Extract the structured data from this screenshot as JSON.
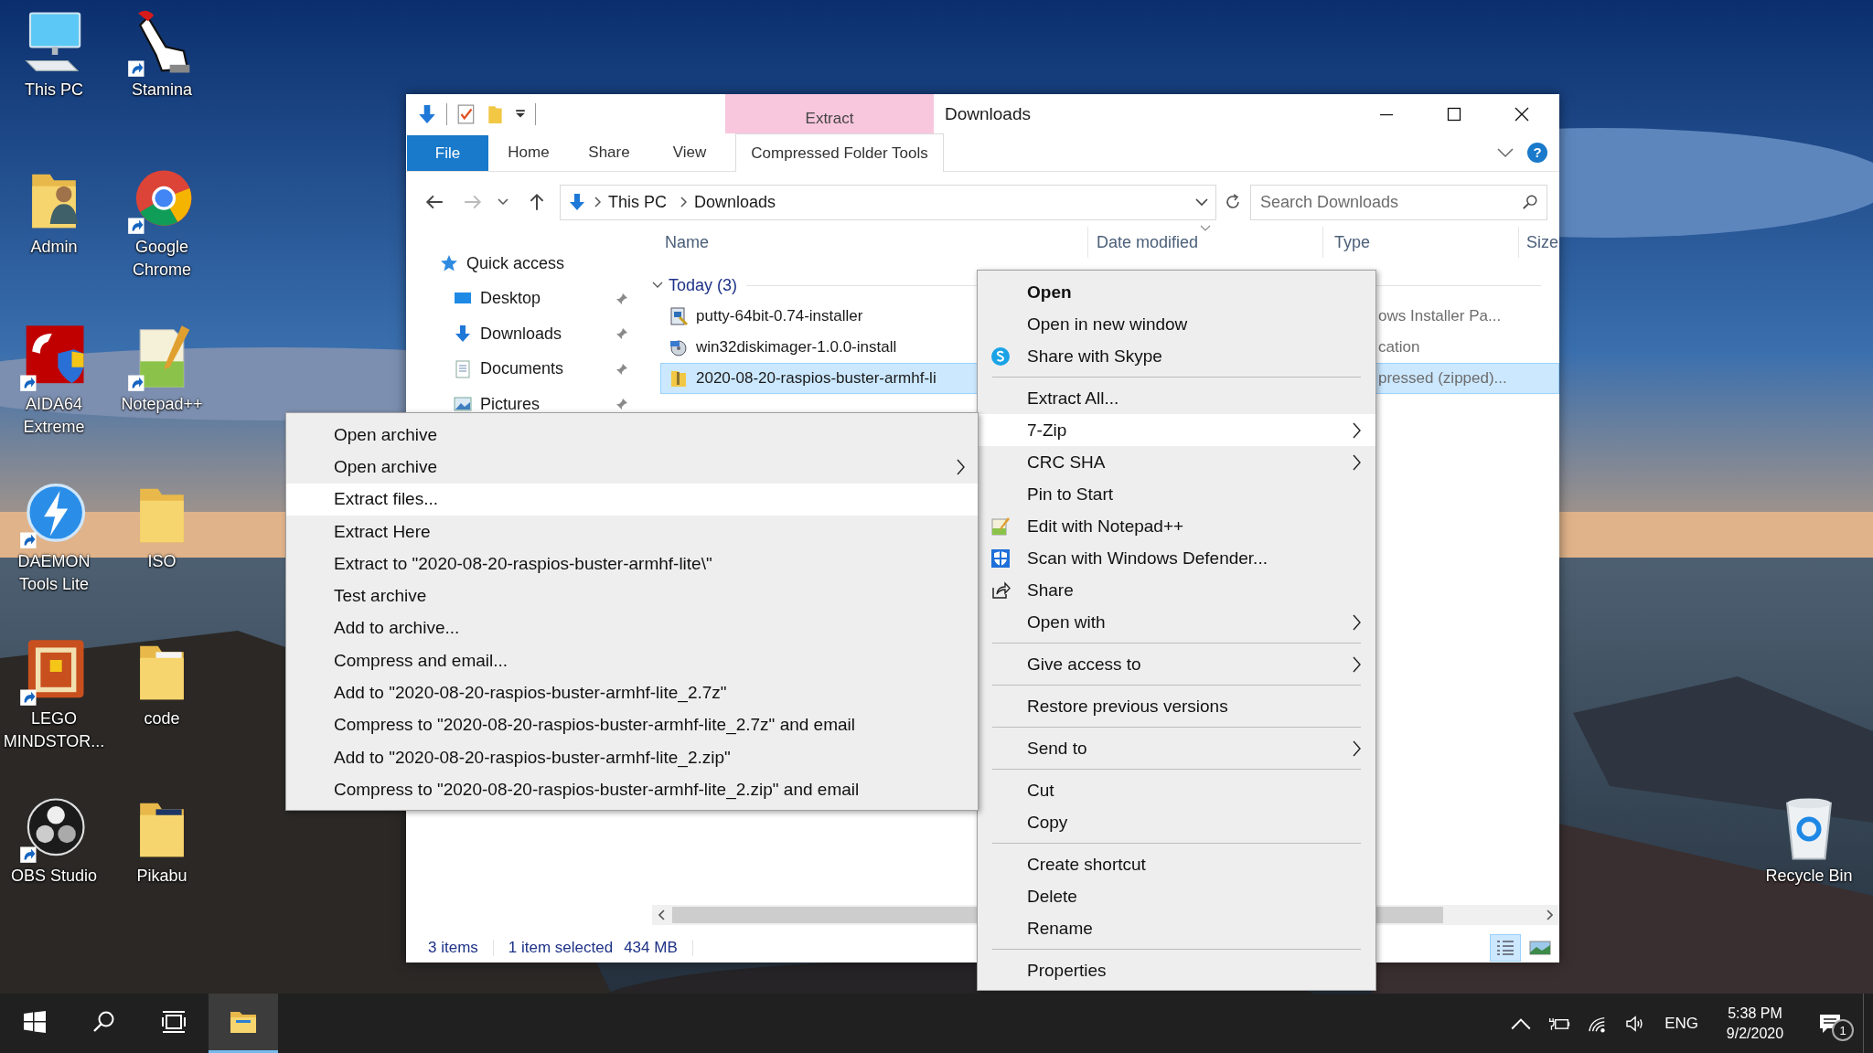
{
  "desktop_icons": [
    {
      "label": "This PC",
      "shortcut": false
    },
    {
      "label": "Stamina",
      "shortcut": true
    },
    {
      "label": "Admin",
      "shortcut": false
    },
    {
      "label": "Google Chrome",
      "shortcut": true
    },
    {
      "label": "AIDA64 Extreme",
      "shortcut": true
    },
    {
      "label": "Notepad++",
      "shortcut": true
    },
    {
      "label": "DAEMON Tools Lite",
      "shortcut": true
    },
    {
      "label": "ISO",
      "shortcut": false
    },
    {
      "label": "LEGO MINDSTOR...",
      "shortcut": true
    },
    {
      "label": "code",
      "shortcut": false
    },
    {
      "label": "OBS Studio",
      "shortcut": true
    },
    {
      "label": "Pikabu",
      "shortcut": false
    }
  ],
  "recycle_bin": {
    "label": "Recycle Bin"
  },
  "explorer": {
    "contextual_group": "Extract",
    "title": "Downloads",
    "ribbon_tabs": [
      {
        "label": "File",
        "kind": "file",
        "selected": false
      },
      {
        "label": "Home",
        "kind": "tab",
        "selected": false
      },
      {
        "label": "Share",
        "kind": "tab",
        "selected": false
      },
      {
        "label": "View",
        "kind": "tab",
        "selected": false
      },
      {
        "label": "Compressed Folder Tools",
        "kind": "contextual",
        "selected": true
      }
    ],
    "help_label": "?",
    "crumbs": [
      "This PC",
      "Downloads"
    ],
    "search": {
      "placeholder": "Search Downloads"
    },
    "nav": [
      {
        "label": "Quick access",
        "children": [
          {
            "label": "Desktop",
            "pinned": true
          },
          {
            "label": "Downloads",
            "pinned": true
          },
          {
            "label": "Documents",
            "pinned": true
          },
          {
            "label": "Pictures",
            "pinned": true
          }
        ]
      }
    ],
    "columns": [
      {
        "label": "Name",
        "sorted": false
      },
      {
        "label": "Date modified",
        "sorted": true
      },
      {
        "label": "Type",
        "sorted": false
      },
      {
        "label": "Size",
        "sorted": false
      }
    ],
    "groups": [
      {
        "label": "Today (3)",
        "expanded": true,
        "files": [
          {
            "name": "putty-64bit-0.74-installer",
            "type": "ows Installer Pa...",
            "kind": "installer",
            "selected": false
          },
          {
            "name": "win32diskimager-1.0.0-install",
            "type": "cation",
            "kind": "program",
            "selected": false
          },
          {
            "name": "2020-08-20-raspios-buster-armhf-li",
            "type": "pressed (zipped)...",
            "kind": "zip",
            "selected": true
          }
        ]
      }
    ],
    "status": {
      "count": "3 items",
      "selection": "1 item selected",
      "size": "434 MB"
    },
    "views": [
      {
        "kind": "details",
        "selected": true
      },
      {
        "kind": "large-icons",
        "selected": false
      }
    ]
  },
  "context_menu": {
    "items": [
      {
        "kind": "item",
        "label": "Open",
        "bold": true,
        "selected": false,
        "submenu": false
      },
      {
        "kind": "item",
        "label": "Open in new window",
        "bold": false,
        "selected": false,
        "submenu": false
      },
      {
        "kind": "item",
        "label": "Share with Skype",
        "bold": false,
        "selected": false,
        "submenu": false
      },
      {
        "kind": "separator"
      },
      {
        "kind": "item",
        "label": "Extract All...",
        "bold": false,
        "selected": false,
        "submenu": false
      },
      {
        "kind": "item",
        "label": "7-Zip",
        "bold": false,
        "selected": true,
        "submenu": true
      },
      {
        "kind": "item",
        "label": "CRC SHA",
        "bold": false,
        "selected": false,
        "submenu": true
      },
      {
        "kind": "item",
        "label": "Pin to Start",
        "bold": false,
        "selected": false,
        "submenu": false
      },
      {
        "kind": "item",
        "label": "Edit with Notepad++",
        "bold": false,
        "selected": false,
        "submenu": false
      },
      {
        "kind": "item",
        "label": "Scan with Windows Defender...",
        "bold": false,
        "selected": false,
        "submenu": false
      },
      {
        "kind": "item",
        "label": "Share",
        "bold": false,
        "selected": false,
        "submenu": false
      },
      {
        "kind": "item",
        "label": "Open with",
        "bold": false,
        "selected": false,
        "submenu": true
      },
      {
        "kind": "separator"
      },
      {
        "kind": "item",
        "label": "Give access to",
        "bold": false,
        "selected": false,
        "submenu": true
      },
      {
        "kind": "separator"
      },
      {
        "kind": "item",
        "label": "Restore previous versions",
        "bold": false,
        "selected": false,
        "submenu": false
      },
      {
        "kind": "separator"
      },
      {
        "kind": "item",
        "label": "Send to",
        "bold": false,
        "selected": false,
        "submenu": true
      },
      {
        "kind": "separator"
      },
      {
        "kind": "item",
        "label": "Cut",
        "bold": false,
        "selected": false,
        "submenu": false
      },
      {
        "kind": "item",
        "label": "Copy",
        "bold": false,
        "selected": false,
        "submenu": false
      },
      {
        "kind": "separator"
      },
      {
        "kind": "item",
        "label": "Create shortcut",
        "bold": false,
        "selected": false,
        "submenu": false
      },
      {
        "kind": "item",
        "label": "Delete",
        "bold": false,
        "selected": false,
        "submenu": false
      },
      {
        "kind": "item",
        "label": "Rename",
        "bold": false,
        "selected": false,
        "submenu": false
      },
      {
        "kind": "separator"
      },
      {
        "kind": "item",
        "label": "Properties",
        "bold": false,
        "selected": false,
        "submenu": false
      }
    ]
  },
  "submenu": {
    "items": [
      {
        "kind": "item",
        "label": "Open archive",
        "selected": false,
        "submenu": false
      },
      {
        "kind": "item",
        "label": "Open archive",
        "selected": false,
        "submenu": true
      },
      {
        "kind": "item",
        "label": "Extract files...",
        "selected": true,
        "submenu": false
      },
      {
        "kind": "item",
        "label": "Extract Here",
        "selected": false,
        "submenu": false
      },
      {
        "kind": "item",
        "label": "Extract to \"2020-08-20-raspios-buster-armhf-lite\\\"",
        "selected": false,
        "submenu": false
      },
      {
        "kind": "item",
        "label": "Test archive",
        "selected": false,
        "submenu": false
      },
      {
        "kind": "item",
        "label": "Add to archive...",
        "selected": false,
        "submenu": false
      },
      {
        "kind": "item",
        "label": "Compress and email...",
        "selected": false,
        "submenu": false
      },
      {
        "kind": "item",
        "label": "Add to \"2020-08-20-raspios-buster-armhf-lite_2.7z\"",
        "selected": false,
        "submenu": false
      },
      {
        "kind": "item",
        "label": "Compress to \"2020-08-20-raspios-buster-armhf-lite_2.7z\" and email",
        "selected": false,
        "submenu": false
      },
      {
        "kind": "item",
        "label": "Add to \"2020-08-20-raspios-buster-armhf-lite_2.zip\"",
        "selected": false,
        "submenu": false
      },
      {
        "kind": "item",
        "label": "Compress to \"2020-08-20-raspios-buster-armhf-lite_2.zip\" and email",
        "selected": false,
        "submenu": false
      }
    ]
  },
  "taskbar": {
    "buttons": [
      {
        "kind": "start",
        "selected": false
      },
      {
        "kind": "search",
        "selected": false
      },
      {
        "kind": "task-view",
        "selected": false
      },
      {
        "kind": "explorer",
        "selected": true
      }
    ],
    "language": "ENG",
    "time": "5:38 PM",
    "date": "9/2/2020",
    "notifications": "1"
  }
}
